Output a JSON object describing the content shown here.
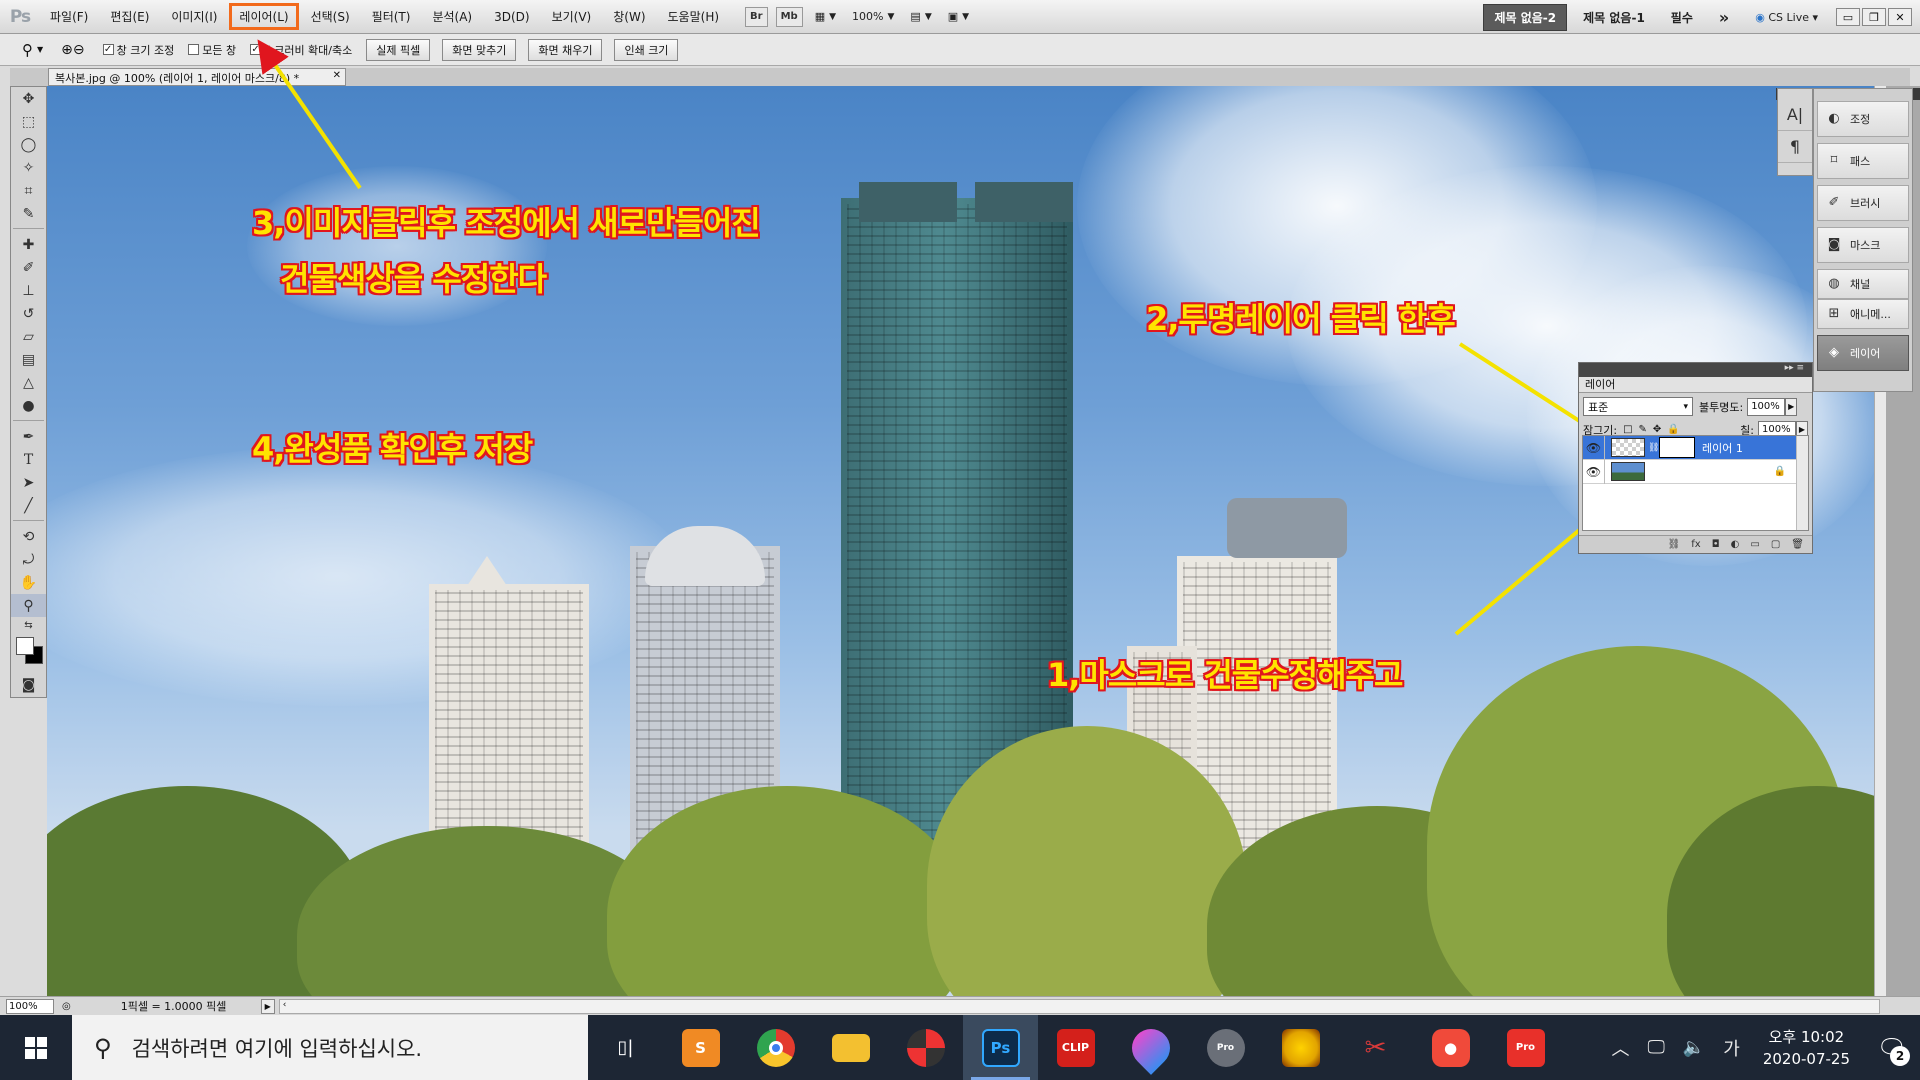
{
  "menubar": {
    "logo": "Ps",
    "items": [
      {
        "label": "파일(F)"
      },
      {
        "label": "편집(E)"
      },
      {
        "label": "이미지(I)"
      },
      {
        "label": "레이어(L)",
        "highlighted": true
      },
      {
        "label": "선택(S)"
      },
      {
        "label": "필터(T)"
      },
      {
        "label": "분석(A)"
      },
      {
        "label": "3D(D)"
      },
      {
        "label": "보기(V)"
      },
      {
        "label": "창(W)"
      },
      {
        "label": "도움말(H)"
      }
    ],
    "bridge_label": "Br",
    "minibridge_label": "Mb",
    "zoom_value": "100%",
    "workspaces": [
      "제목 없음-2",
      "제목 없음-1",
      "필수"
    ],
    "overflow": "»",
    "cslive": "CS Live",
    "window_controls": [
      "minimize",
      "restore",
      "close"
    ]
  },
  "options": {
    "checks": [
      {
        "label": "창 크기 조정",
        "checked": true
      },
      {
        "label": "모든 창",
        "checked": false
      },
      {
        "label": "스크러비 확대/축소",
        "checked": true
      }
    ],
    "buttons": [
      "실제 픽셀",
      "화면 맞추기",
      "화면 채우기",
      "인쇄 크기"
    ]
  },
  "document": {
    "tab_title": "복사본.jpg @ 100% (레이어 1, 레이어 마스크/8) *"
  },
  "annotations": {
    "step3_line1": "3,이미지클릭후 조정에서 새로만들어진",
    "step3_line2": "건물색상을 수정한다",
    "step2": "2,투명레이어 클릭 한후",
    "step4": "4,완성품 확인후 저장",
    "step1": "1,마스크로 건물수정해주고"
  },
  "dock": {
    "narrow": [
      "A|",
      "¶"
    ],
    "items": [
      {
        "label": "조정",
        "icon": "adjustments-icon"
      },
      {
        "label": "패스",
        "icon": "paths-icon"
      },
      {
        "label": "브러시",
        "icon": "brush-icon"
      },
      {
        "label": "마스크",
        "icon": "masks-icon"
      },
      {
        "label": "채널",
        "icon": "channels-icon"
      },
      {
        "label": "애니메...",
        "icon": "animation-icon"
      },
      {
        "label": "레이어",
        "icon": "layers-icon",
        "active": true
      }
    ]
  },
  "layers_panel": {
    "tab": "레이어",
    "blend_mode": "표준",
    "opacity_label": "불투명도:",
    "opacity_value": "100%",
    "lock_label": "잠그기:",
    "fill_label": "칠:",
    "fill_value": "100%",
    "layers": [
      {
        "name": "레이어 1",
        "selected": true,
        "has_mask": true
      },
      {
        "name": "",
        "selected": false,
        "locked": true
      }
    ]
  },
  "status": {
    "zoom": "100%",
    "info": "1픽셀 = 1.0000 픽셀"
  },
  "taskbar": {
    "search_placeholder": "검색하려면 여기에 입력하십시오.",
    "apps": [
      {
        "name": "task-view",
        "label": "▯|"
      },
      {
        "name": "sublime",
        "label": "S",
        "color": "#f08a24"
      },
      {
        "name": "chrome",
        "label": "",
        "color": "#e33b2e"
      },
      {
        "name": "file-explorer",
        "label": "",
        "color": "#f3c030"
      },
      {
        "name": "photoscape",
        "label": "",
        "color": "#2a2a2a"
      },
      {
        "name": "photoshop",
        "label": "Ps",
        "color": "#0d2b4a",
        "active": true
      },
      {
        "name": "clip",
        "label": "CLIP",
        "color": "#d4201b"
      },
      {
        "name": "drop",
        "label": "",
        "color": "#c14bd6"
      },
      {
        "name": "globe-pro",
        "label": "Pro",
        "color": "#6a6f78"
      },
      {
        "name": "burst",
        "label": "",
        "color": "#e2a400"
      },
      {
        "name": "scissors",
        "label": "",
        "color": "#d83a3a"
      },
      {
        "name": "camera-app",
        "label": "",
        "color": "#f04a3a"
      },
      {
        "name": "crop-pro",
        "label": "Pro",
        "color": "#e8302a"
      }
    ],
    "tray_ime": "가",
    "time": "오후 10:02",
    "date": "2020-07-25",
    "notification_count": "2"
  }
}
